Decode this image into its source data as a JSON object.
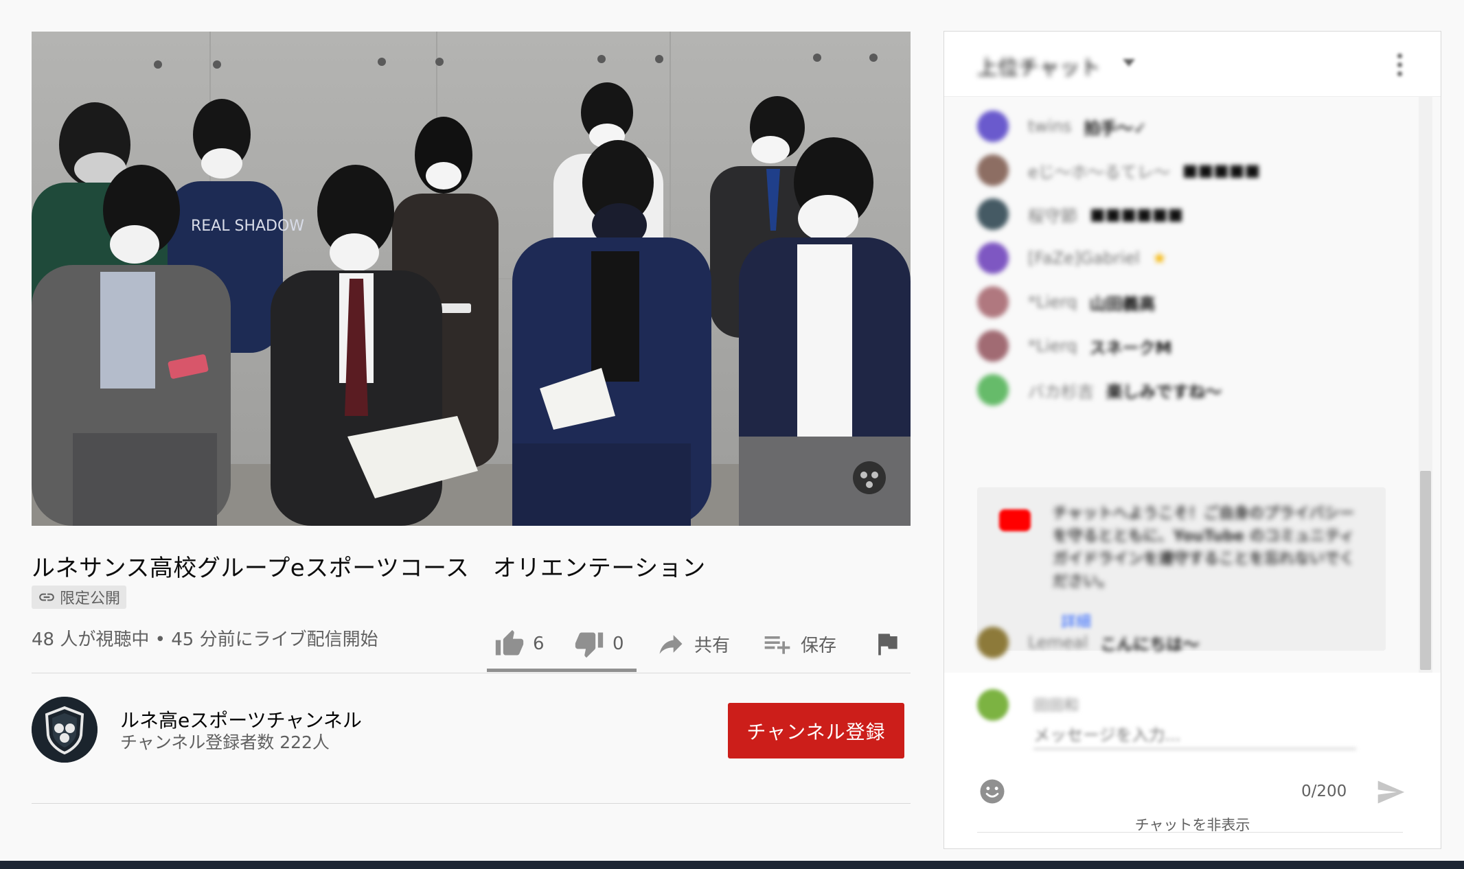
{
  "video": {
    "title": "ルネサンス高校グループeスポーツコース　オリエンテーション",
    "visibility_badge": "限定公開",
    "viewer_info": "48 人が視聴中 • 45 分前にライブ配信開始",
    "like_count": "6",
    "dislike_count": "0",
    "share_label": "共有",
    "save_label": "保存",
    "shirt_text": "REAL SHADOW",
    "like_ratio": 1.0
  },
  "channel": {
    "name": "ルネ高eスポーツチャンネル",
    "subscribers": "チャンネル登録者数 222人",
    "subscribe_label": "チャンネル登録"
  },
  "chat": {
    "header_title": "上位チャット",
    "messages": [
      {
        "author": "twins",
        "text": "拍手〜✓",
        "color": "#6a5acd"
      },
      {
        "author": "eじ〜ホ〜るてレ〜",
        "text": "■■■■■",
        "color": "#8d6e63"
      },
      {
        "author": "桜守節",
        "text": "■■■■■■",
        "color": "#455a64"
      },
      {
        "author": "[FaZe]Gabriel",
        "text": "★",
        "color": "#7e57c2"
      },
      {
        "author": "*Lierq",
        "text": "山田義高",
        "color": "#b0787f"
      },
      {
        "author": "*Lierq",
        "text": "スネークM",
        "color": "#a16b73"
      },
      {
        "author": "バカ杉吉",
        "text": "楽しみですね〜",
        "color": "#66bb6a"
      },
      {
        "author": "Lemeal",
        "text": "こんにちは〜",
        "color": "#8d7a3a"
      }
    ],
    "welcome": {
      "text": "チャットへようこそ！ご自身のプライバシーを守るとともに、YouTube のコミュニティ ガイドラインを遵守することを忘れないでください。",
      "link": "詳細"
    },
    "input": {
      "user_name": "田田和",
      "placeholder": "メッセージを入力..."
    },
    "counter": "0/200",
    "hide_label": "チャットを非表示"
  },
  "colors": {
    "subscribe_red": "#cc1e1a",
    "icon_gray": "#909090",
    "text_secondary": "#606060"
  }
}
